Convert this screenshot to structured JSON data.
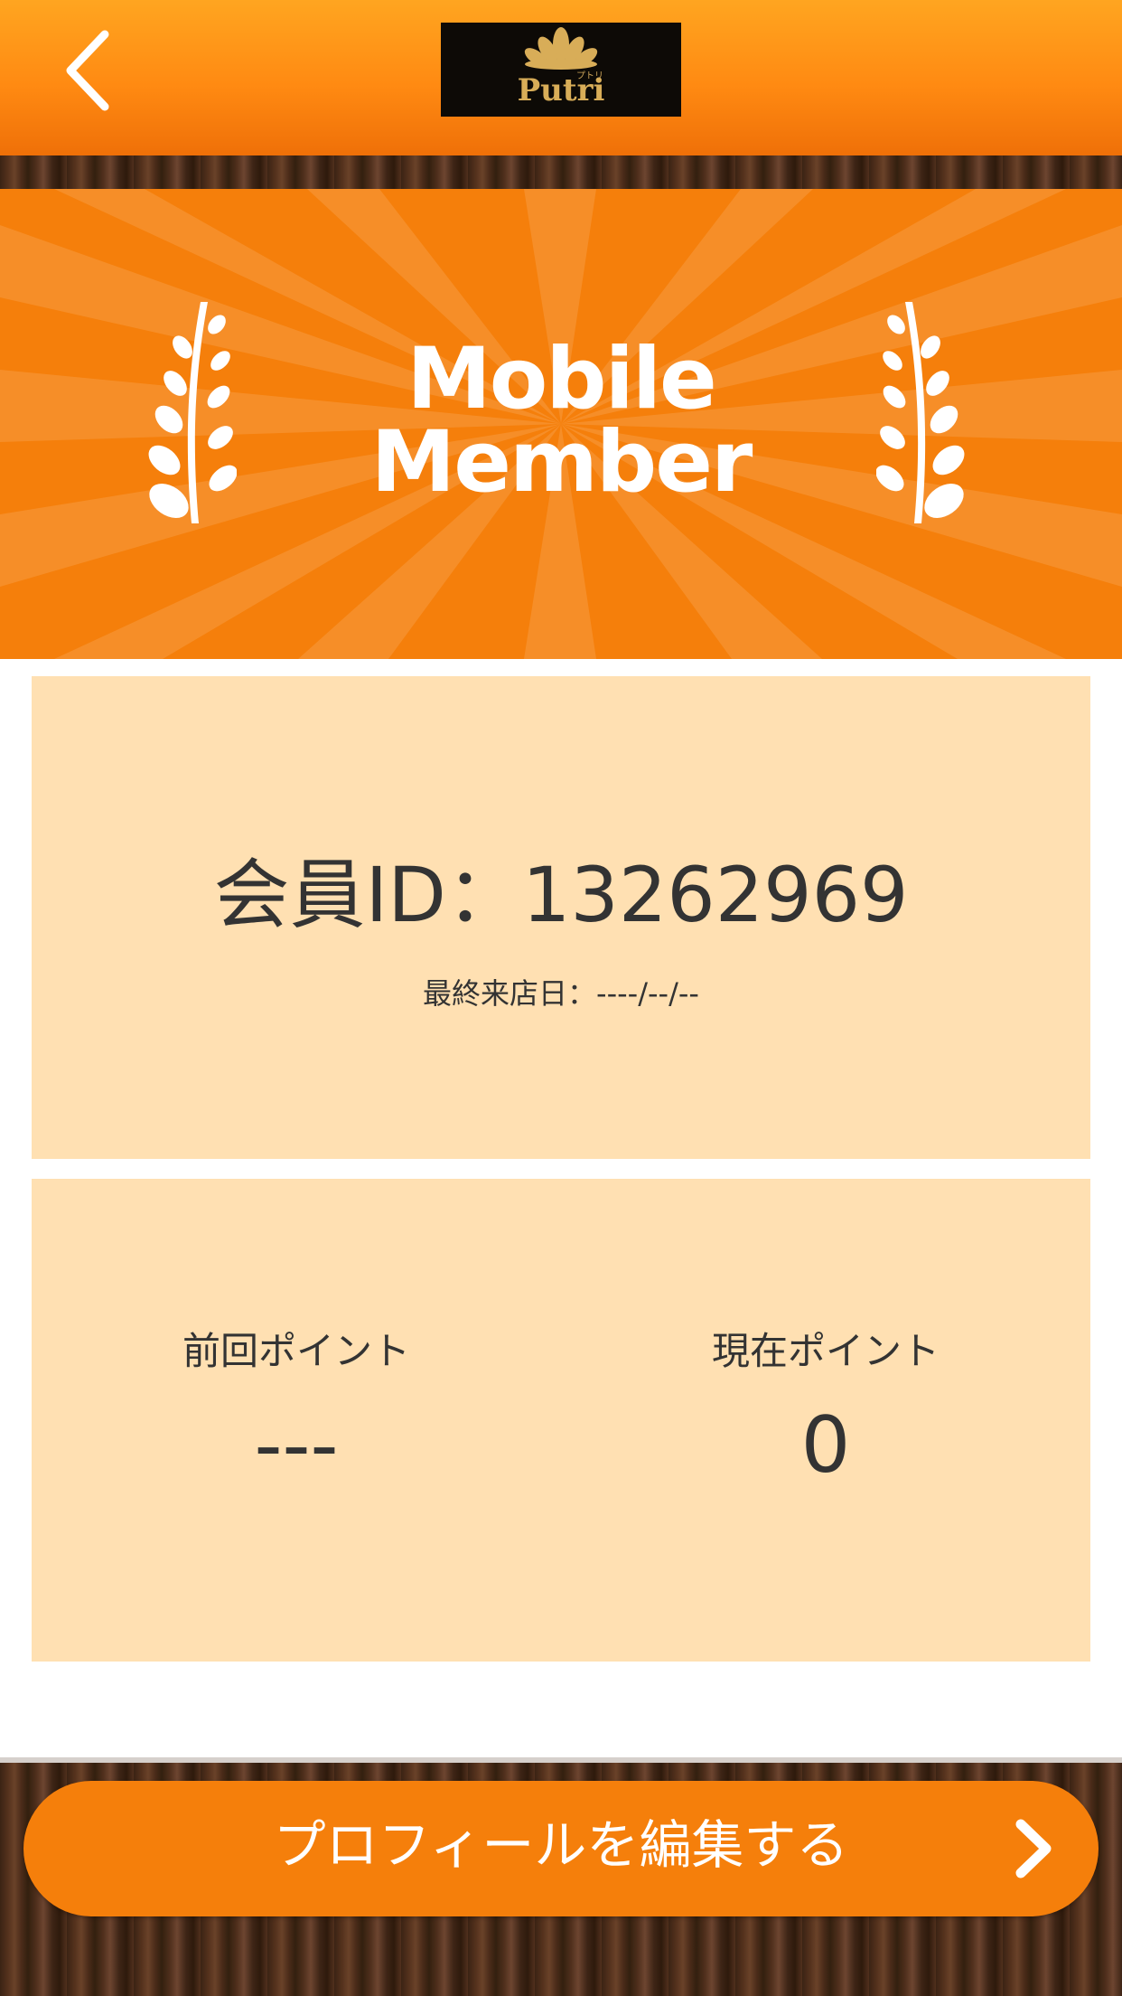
{
  "header": {
    "back_icon": "chevron-left-icon",
    "logo_text": "Putri",
    "logo_subtext": "プトリ"
  },
  "banner": {
    "title_line1": "Mobile",
    "title_line2": "Member",
    "decoration_icon": "laurel-icon"
  },
  "member": {
    "id_label": "会員ID：13262969",
    "last_visit_label": "最終来店日：----/--/--"
  },
  "points": {
    "previous_label": "前回ポイント",
    "previous_value": "---",
    "current_label": "現在ポイント",
    "current_value": "0"
  },
  "footer": {
    "edit_profile_label": "プロフィールを編集する",
    "edit_profile_icon": "chevron-right-icon"
  },
  "colors": {
    "accent": "#f57f0b",
    "card_background": "#ffe0b2",
    "text": "#333333"
  }
}
